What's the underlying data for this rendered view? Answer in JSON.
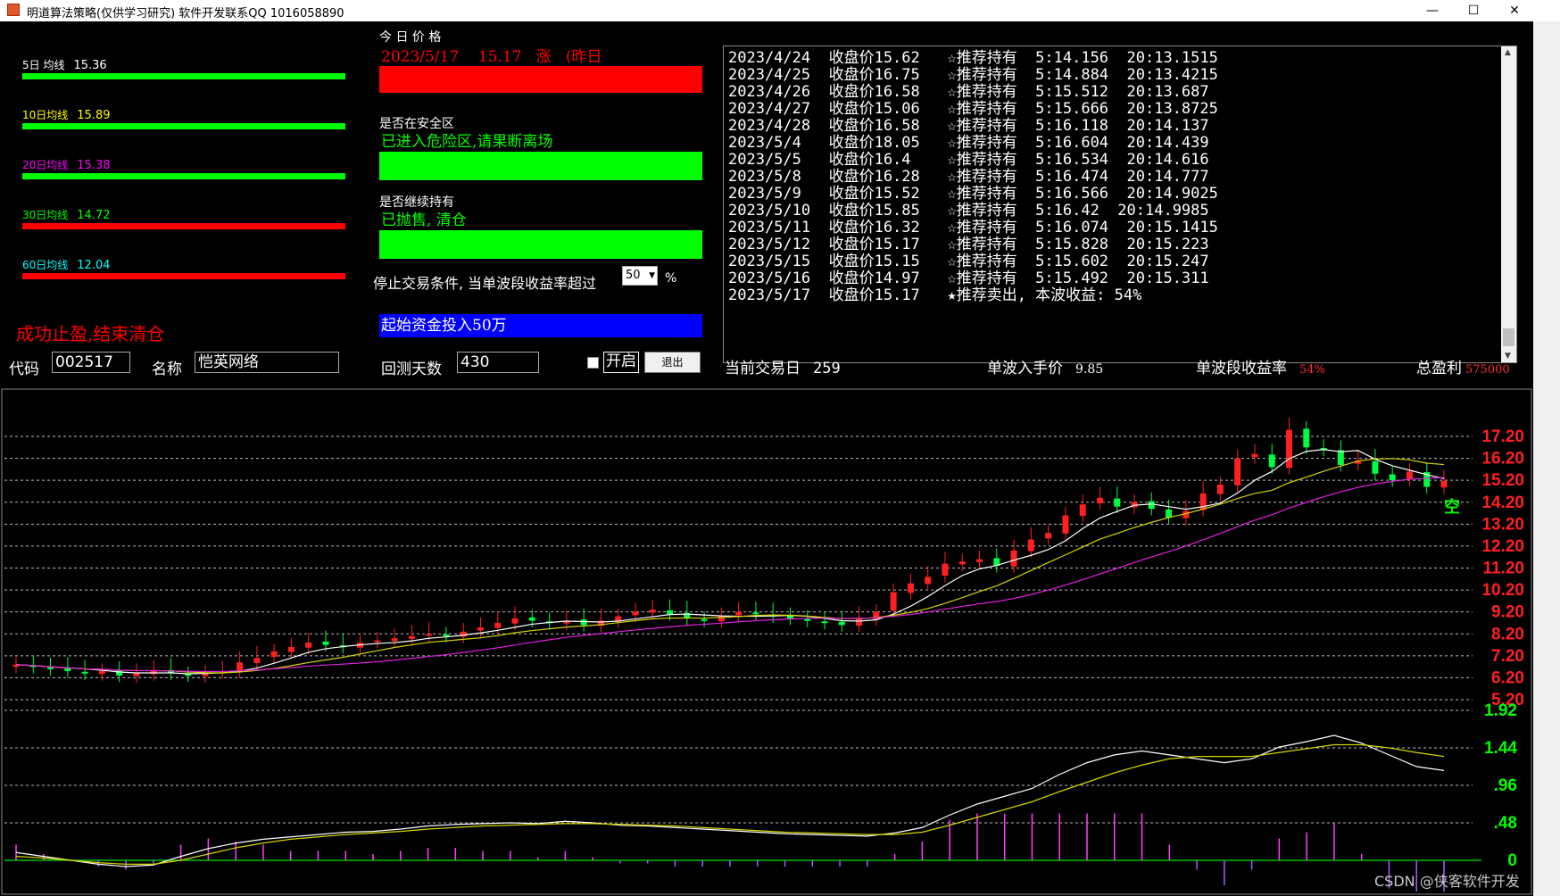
{
  "window": {
    "title": "明道算法策略(仅供学习研究) 软件开发联系QQ 1016058890",
    "minimize": "—",
    "maximize": "☐",
    "close": "✕"
  },
  "ma_bars": [
    {
      "label": "5日 均线",
      "value": "15.36",
      "color": "#00ff00",
      "text_color": "#ffffff"
    },
    {
      "label": "10日均线",
      "value": "15.89",
      "color": "#00ff00",
      "text_color": "#ffff00"
    },
    {
      "label": "20日均线",
      "value": "15.38",
      "color": "#00ff00",
      "text_color": "#ff00ff"
    },
    {
      "label": "30日均线",
      "value": "14.72",
      "color": "#ff0000",
      "text_color": "#00ff00"
    },
    {
      "label": "60日均线",
      "value": "12.04",
      "color": "#ff0000",
      "text_color": "#00ffff"
    }
  ],
  "today": {
    "heading": "今 日 价 格",
    "line": "2023/5/17    15.17   涨   (昨日"
  },
  "safe_zone": {
    "label": "是否在安全区",
    "status": "已进入危险区,请果断离场"
  },
  "hold": {
    "label": "是否继续持有",
    "status": "已抛售, 清仓"
  },
  "stop_condition": {
    "label": "停止交易条件, 当单波段收益率超过",
    "value": "50",
    "unit": "%"
  },
  "capital_banner": "起始资金投入50万",
  "success_msg": "成功止盈,结束清仓",
  "form": {
    "code_label": "代码",
    "code_value": "002517",
    "name_label": "名称",
    "name_value": "恺英网络",
    "days_label": "回测天数",
    "days_value": "430",
    "start_label": "开启",
    "exit_label": "退出"
  },
  "log_lines": [
    "2023/4/24  收盘价15.62   ☆推荐持有  5:14.156  20:13.1515",
    "2023/4/25  收盘价16.75   ☆推荐持有  5:14.884  20:13.4215",
    "2023/4/26  收盘价16.58   ☆推荐持有  5:15.512  20:13.687",
    "2023/4/27  收盘价15.06   ☆推荐持有  5:15.666  20:13.8725",
    "2023/4/28  收盘价16.58   ☆推荐持有  5:16.118  20:14.137",
    "2023/5/4   收盘价18.05   ☆推荐持有  5:16.604  20:14.439",
    "2023/5/5   收盘价16.4    ☆推荐持有  5:16.534  20:14.616",
    "2023/5/8   收盘价16.28   ☆推荐持有  5:16.474  20:14.777",
    "2023/5/9   收盘价15.52   ☆推荐持有  5:16.566  20:14.9025",
    "2023/5/10  收盘价15.85   ☆推荐持有  5:16.42  20:14.9985",
    "2023/5/11  收盘价16.32   ☆推荐持有  5:16.074  20:15.1415",
    "2023/5/12  收盘价15.17   ☆推荐持有  5:15.828  20:15.223",
    "2023/5/15  收盘价15.15   ☆推荐持有  5:15.602  20:15.247",
    "2023/5/16  收盘价14.97   ☆推荐持有  5:15.492  20:15.311",
    "2023/5/17  收盘价15.17   ★推荐卖出, 本波收益: 54%"
  ],
  "status_bar": {
    "trade_day_label": "当前交易日",
    "trade_day_value": "259",
    "entry_label": "单波入手价",
    "entry_value": "9.85",
    "wave_return_label": "单波段收益率",
    "wave_return_value": "54%",
    "total_profit_label": "总盈利",
    "total_profit_value": "575000"
  },
  "price_axis": [
    "17.20",
    "16.20",
    "15.20",
    "14.20",
    "13.20",
    "12.20",
    "11.20",
    "10.20",
    "9.20",
    "8.20",
    "7.20",
    "6.20",
    "5.20"
  ],
  "macd_axis": [
    "1.92",
    "1.44",
    ".96",
    ".48",
    "0"
  ],
  "signal_text": "空",
  "watermark": "CSDN @侠客软件开发",
  "chart_data": {
    "type": "candlestick",
    "series": [
      {
        "name": "price",
        "values": [
          6.8,
          6.7,
          6.6,
          6.5,
          6.4,
          6.5,
          6.3,
          6.4,
          6.5,
          6.4,
          6.3,
          6.4,
          6.5,
          6.9,
          7.1,
          7.4,
          7.6,
          7.8,
          7.7,
          7.6,
          7.8,
          7.9,
          8.0,
          8.1,
          8.2,
          8.1,
          8.3,
          8.5,
          8.7,
          8.9,
          8.8,
          8.7,
          8.8,
          8.6,
          8.8,
          9.0,
          9.2,
          9.3,
          9.1,
          8.9,
          8.8,
          9.0,
          9.2,
          9.1,
          9.0,
          8.9,
          8.8,
          8.7,
          8.6,
          8.9,
          9.2,
          10.1,
          10.5,
          10.8,
          11.4,
          11.5,
          11.6,
          11.3,
          12.0,
          12.5,
          12.8,
          13.6,
          14.1,
          14.4,
          14.0,
          14.2,
          13.9,
          13.5,
          13.8,
          14.6,
          15.0,
          16.2,
          16.4,
          15.8,
          17.5,
          16.7,
          16.6,
          15.9,
          16.1,
          15.5,
          15.2,
          15.6,
          14.9,
          15.17
        ]
      }
    ],
    "macd_dif": [
      0.1,
      0.05,
      0.0,
      -0.05,
      -0.08,
      -0.06,
      0.05,
      0.15,
      0.22,
      0.27,
      0.3,
      0.33,
      0.36,
      0.37,
      0.4,
      0.44,
      0.46,
      0.47,
      0.48,
      0.47,
      0.5,
      0.48,
      0.45,
      0.44,
      0.42,
      0.4,
      0.38,
      0.36,
      0.34,
      0.33,
      0.32,
      0.31,
      0.35,
      0.42,
      0.58,
      0.72,
      0.82,
      0.92,
      1.1,
      1.25,
      1.35,
      1.4,
      1.35,
      1.3,
      1.25,
      1.3,
      1.45,
      1.52,
      1.6,
      1.5,
      1.35,
      1.2,
      1.15
    ],
    "macd_dea": [
      0.05,
      0.03,
      0.0,
      -0.03,
      -0.05,
      -0.05,
      0.0,
      0.08,
      0.16,
      0.22,
      0.27,
      0.3,
      0.33,
      0.35,
      0.37,
      0.4,
      0.42,
      0.44,
      0.45,
      0.46,
      0.47,
      0.47,
      0.46,
      0.45,
      0.44,
      0.42,
      0.4,
      0.38,
      0.36,
      0.35,
      0.34,
      0.33,
      0.33,
      0.36,
      0.45,
      0.55,
      0.65,
      0.75,
      0.88,
      1.0,
      1.12,
      1.22,
      1.3,
      1.33,
      1.33,
      1.33,
      1.38,
      1.43,
      1.48,
      1.48,
      1.44,
      1.38,
      1.33
    ],
    "ylim_price": [
      5.2,
      17.2
    ],
    "ylim_macd": [
      0,
      1.92
    ]
  }
}
